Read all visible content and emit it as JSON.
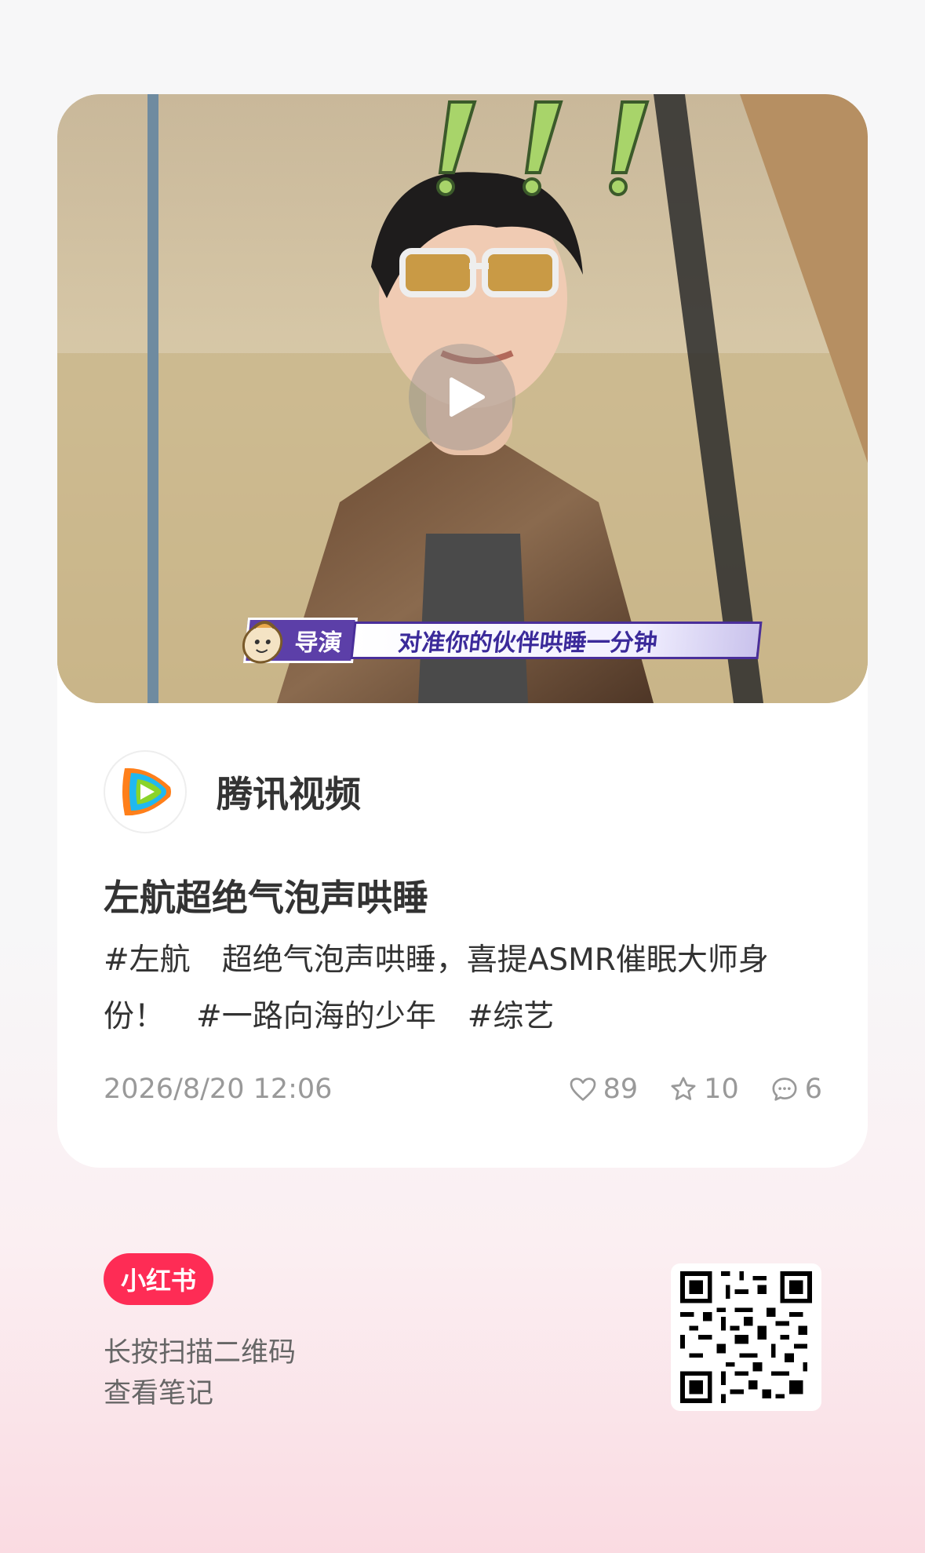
{
  "video": {
    "caption_tag": "导演",
    "caption_text": "对准你的伙伴哄睡一分钟"
  },
  "author": {
    "name": "腾讯视频",
    "avatar_icon": "tencent-video-logo-icon"
  },
  "note": {
    "title": "左航超绝气泡声哄睡",
    "desc_line1_a": "#左航",
    "desc_line1_b": "超绝气泡声哄睡，喜提ASMR催眠大师身",
    "desc_line2_a": "份！",
    "desc_line2_b": "#一路向海的少年",
    "desc_line2_c": "#综艺",
    "date": "2026/8/20 12:06"
  },
  "stats": {
    "likes": "89",
    "favorites": "10",
    "comments": "6"
  },
  "footer": {
    "brand": "小红书",
    "line1": "长按扫描二维码",
    "line2": "查看笔记"
  },
  "colors": {
    "brand": "#fe2c55",
    "text": "#333333",
    "muted": "#999999"
  }
}
